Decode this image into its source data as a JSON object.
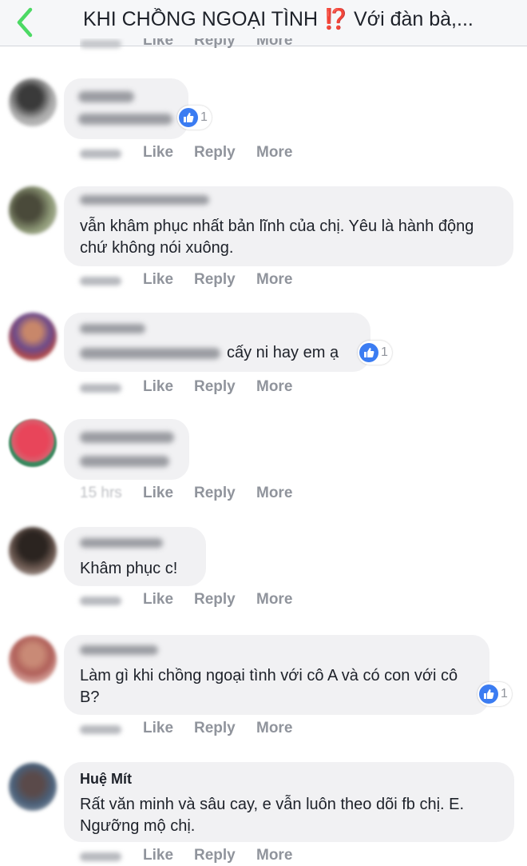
{
  "header": {
    "title": "KHI CHỒNG NGOẠI TÌNH ⁉️ Với đàn bà,..."
  },
  "peek": {
    "like": "Like",
    "reply": "Reply",
    "more": "More"
  },
  "actions": {
    "like": "Like",
    "reply": "Reply",
    "more": "More"
  },
  "comments": [
    {
      "text": "",
      "time": "",
      "reactions": "1"
    },
    {
      "text": "vẫn khâm phục nhất bản lĩnh của chị. Yêu là hành động chứ không nói xuông.",
      "time": ""
    },
    {
      "text": "cấy ni hay em ạ",
      "time": "",
      "reactions": "1"
    },
    {
      "text": "",
      "time": "15 hrs"
    },
    {
      "text": "Khâm phục c!",
      "time": ""
    },
    {
      "text": "Làm gì khi chồng ngoại tình với cô A và có con với cô B?",
      "time": "",
      "reactions": "1"
    },
    {
      "name": "Huệ Mít",
      "text": "Rất văn minh và sâu cay, e vẫn luôn theo dõi fb chị. E. Ngưỡng mộ chị.",
      "time": ""
    }
  ],
  "colors": {
    "back_arrow": "#4cd964",
    "reaction_blue": "#3b7cf2",
    "bubble": "#f1f1f3",
    "meta_gray": "#90949c"
  }
}
